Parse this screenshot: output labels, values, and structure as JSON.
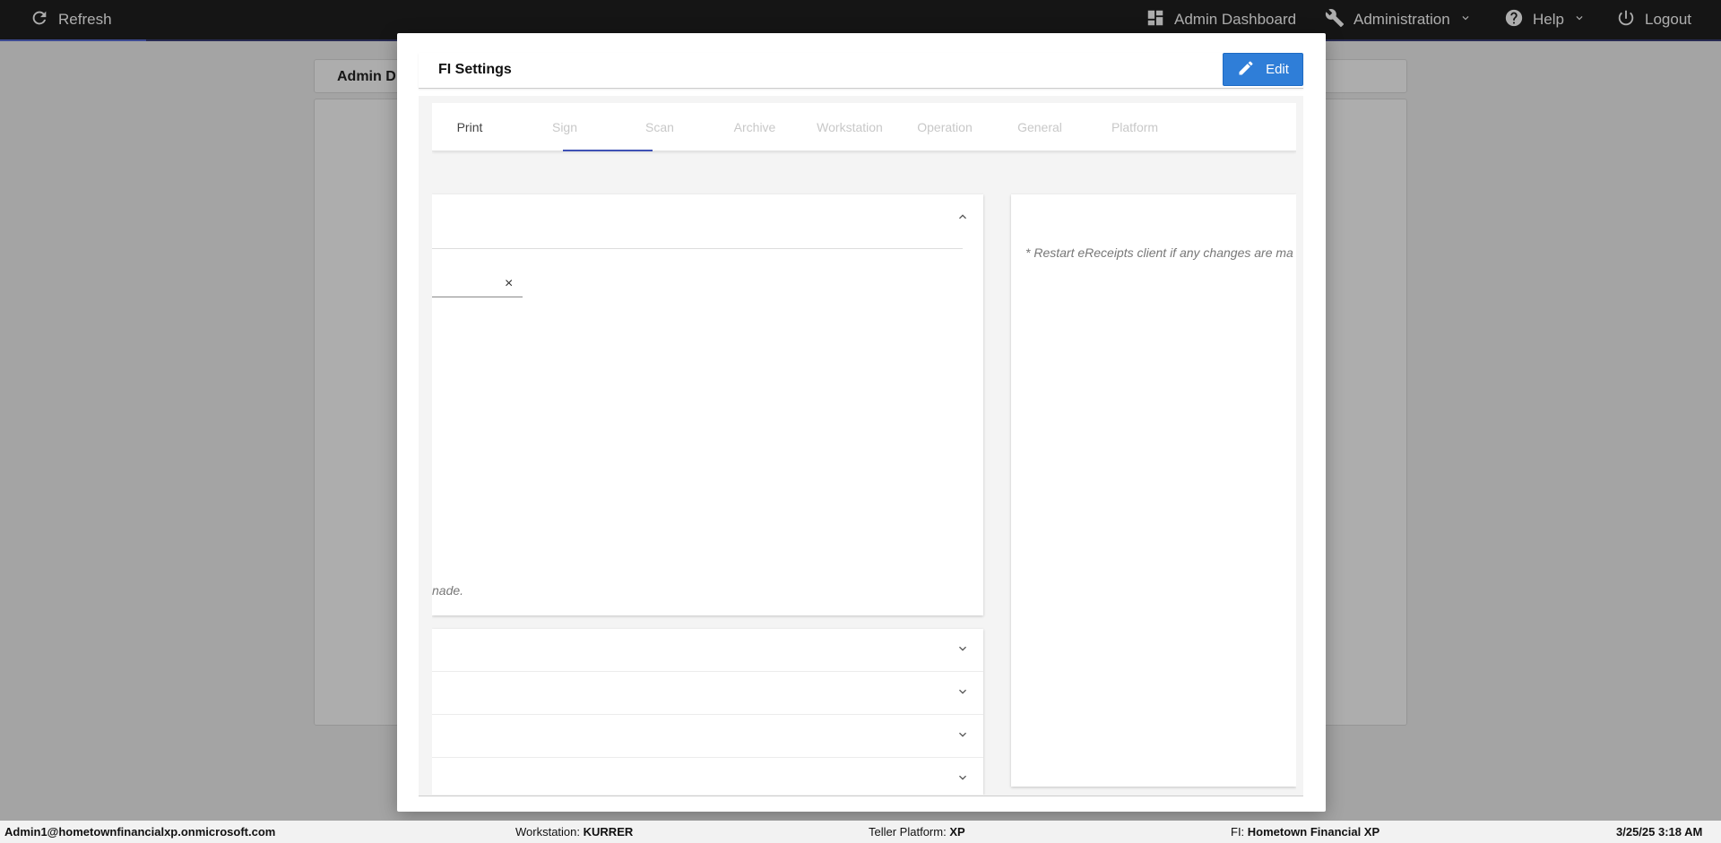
{
  "topbar": {
    "refresh_label": "Refresh",
    "admin_dashboard_label": "Admin Dashboard",
    "administration_label": "Administration",
    "help_label": "Help",
    "logout_label": "Logout",
    "progress_fraction": 0.085
  },
  "background": {
    "header_title": "Admin D"
  },
  "modal": {
    "title": "FI Settings",
    "edit_label": "Edit",
    "tabs": [
      {
        "label": "Print"
      },
      {
        "label": "Sign"
      },
      {
        "label": "Scan"
      },
      {
        "label": "Archive"
      },
      {
        "label": "Workstation"
      },
      {
        "label": "Operation"
      },
      {
        "label": "General"
      },
      {
        "label": "Platform"
      }
    ],
    "active_tab": "Sign",
    "left_card_note": "nade.",
    "clear_symbol": "×",
    "right_card_note": "* Restart eReceipts client if any changes are ma"
  },
  "footer": {
    "user": "Admin1@hometownfinancialxp.onmicrosoft.com",
    "workstation_label": "Workstation:",
    "workstation_value": "KURRER",
    "teller_platform_label": "Teller Platform:",
    "teller_platform_value": "XP",
    "fi_label": "FI:",
    "fi_value": "Hometown Financial XP",
    "datetime": "3/25/25 3:18 AM"
  },
  "colors": {
    "topbar_bg": "#1f1f1f",
    "accent": "#3f51b5",
    "edit_button": "#2f7ed8"
  }
}
